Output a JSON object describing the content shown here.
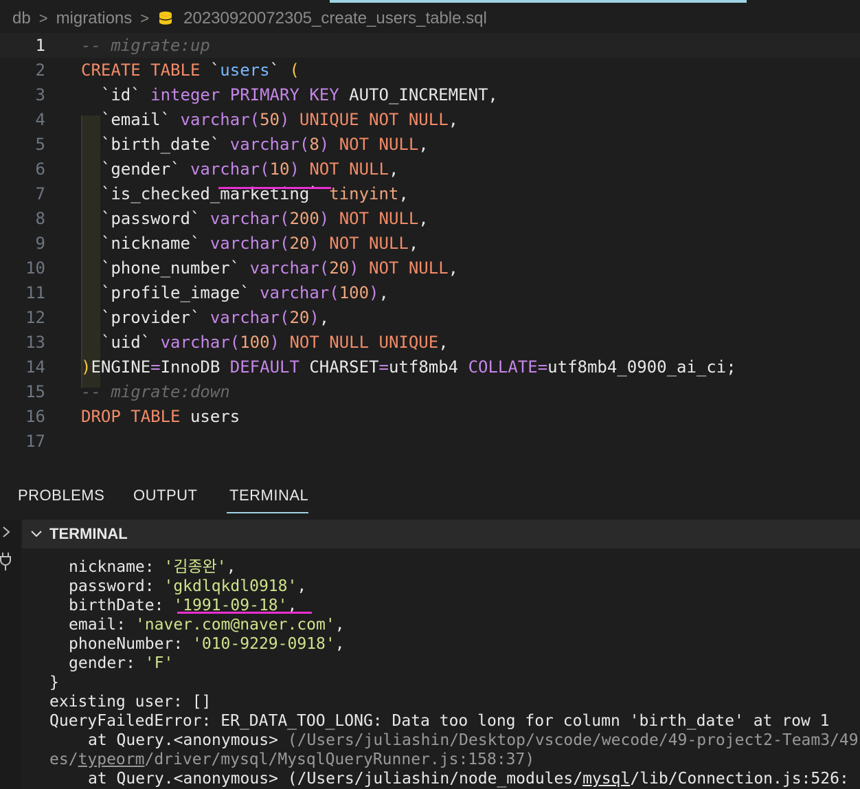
{
  "breadcrumb": {
    "items": [
      "db",
      "migrations",
      "20230920072305_create_users_table.sql"
    ],
    "separator": ">"
  },
  "editor": {
    "lines": [
      {
        "num": "1",
        "parts": [
          {
            "cls": "c",
            "text": "-- migrate:up"
          }
        ]
      },
      {
        "num": "2",
        "parts": [
          {
            "cls": "k",
            "text": "CREATE TABLE "
          },
          {
            "cls": "w",
            "text": "`"
          },
          {
            "cls": "b",
            "text": "users"
          },
          {
            "cls": "w",
            "text": "` "
          },
          {
            "cls": "p",
            "text": "("
          }
        ]
      },
      {
        "num": "3",
        "parts": [
          {
            "cls": "w",
            "text": "  `id` "
          },
          {
            "cls": "t",
            "text": "integer "
          },
          {
            "cls": "t",
            "text": "PRIMARY KEY "
          },
          {
            "cls": "w",
            "text": "AUTO_INCREMENT,"
          }
        ]
      },
      {
        "num": "4",
        "parts": [
          {
            "cls": "w",
            "text": "  `email` "
          },
          {
            "cls": "t",
            "text": "varchar("
          },
          {
            "cls": "n",
            "text": "50"
          },
          {
            "cls": "t",
            "text": ") "
          },
          {
            "cls": "k",
            "text": "UNIQUE NOT NULL"
          },
          {
            "cls": "w",
            "text": ","
          }
        ]
      },
      {
        "num": "5",
        "parts": [
          {
            "cls": "w",
            "text": "  `birth_date` "
          },
          {
            "cls": "t",
            "text": "varchar("
          },
          {
            "cls": "n",
            "text": "8"
          },
          {
            "cls": "t",
            "text": ") "
          },
          {
            "cls": "k",
            "text": "NOT NULL"
          },
          {
            "cls": "w",
            "text": ","
          }
        ]
      },
      {
        "num": "6",
        "parts": [
          {
            "cls": "w",
            "text": "  `gender` "
          },
          {
            "cls": "t",
            "text": "varchar("
          },
          {
            "cls": "n",
            "text": "10"
          },
          {
            "cls": "t",
            "text": ") "
          },
          {
            "cls": "k",
            "text": "NOT NULL"
          },
          {
            "cls": "w",
            "text": ","
          }
        ]
      },
      {
        "num": "7",
        "parts": [
          {
            "cls": "w",
            "text": "  `is_checked_marketing` "
          },
          {
            "cls": "n",
            "text": "tinyint"
          },
          {
            "cls": "w",
            "text": ","
          }
        ]
      },
      {
        "num": "8",
        "parts": [
          {
            "cls": "w",
            "text": "  `password` "
          },
          {
            "cls": "t",
            "text": "varchar("
          },
          {
            "cls": "n",
            "text": "200"
          },
          {
            "cls": "t",
            "text": ") "
          },
          {
            "cls": "k",
            "text": "NOT NULL"
          },
          {
            "cls": "w",
            "text": ","
          }
        ]
      },
      {
        "num": "9",
        "parts": [
          {
            "cls": "w",
            "text": "  `nickname` "
          },
          {
            "cls": "t",
            "text": "varchar("
          },
          {
            "cls": "n",
            "text": "20"
          },
          {
            "cls": "t",
            "text": ") "
          },
          {
            "cls": "k",
            "text": "NOT NULL"
          },
          {
            "cls": "w",
            "text": ","
          }
        ]
      },
      {
        "num": "10",
        "parts": [
          {
            "cls": "w",
            "text": "  `phone_number` "
          },
          {
            "cls": "t",
            "text": "varchar("
          },
          {
            "cls": "n",
            "text": "20"
          },
          {
            "cls": "t",
            "text": ") "
          },
          {
            "cls": "k",
            "text": "NOT NULL"
          },
          {
            "cls": "w",
            "text": ","
          }
        ]
      },
      {
        "num": "11",
        "parts": [
          {
            "cls": "w",
            "text": "  `profile_image` "
          },
          {
            "cls": "t",
            "text": "varchar("
          },
          {
            "cls": "n",
            "text": "100"
          },
          {
            "cls": "t",
            "text": ")"
          },
          {
            "cls": "w",
            "text": ","
          }
        ]
      },
      {
        "num": "12",
        "parts": [
          {
            "cls": "w",
            "text": "  `provider` "
          },
          {
            "cls": "t",
            "text": "varchar("
          },
          {
            "cls": "n",
            "text": "20"
          },
          {
            "cls": "t",
            "text": ")"
          },
          {
            "cls": "w",
            "text": ","
          }
        ]
      },
      {
        "num": "13",
        "parts": [
          {
            "cls": "w",
            "text": "  `uid` "
          },
          {
            "cls": "t",
            "text": "varchar("
          },
          {
            "cls": "n",
            "text": "100"
          },
          {
            "cls": "t",
            "text": ") "
          },
          {
            "cls": "k",
            "text": "NOT NULL UNIQUE"
          },
          {
            "cls": "w",
            "text": ","
          }
        ]
      },
      {
        "num": "14",
        "parts": [
          {
            "cls": "p",
            "text": ")"
          },
          {
            "cls": "w",
            "text": "ENGINE"
          },
          {
            "cls": "t",
            "text": "="
          },
          {
            "cls": "w",
            "text": "InnoDB "
          },
          {
            "cls": "t",
            "text": "DEFAULT "
          },
          {
            "cls": "w",
            "text": "CHARSET"
          },
          {
            "cls": "t",
            "text": "="
          },
          {
            "cls": "w",
            "text": "utf8mb4 "
          },
          {
            "cls": "t",
            "text": "COLLATE"
          },
          {
            "cls": "t",
            "text": "="
          },
          {
            "cls": "w",
            "text": "utf8mb4_0900_ai_ci;"
          }
        ]
      },
      {
        "num": "15",
        "parts": [
          {
            "cls": "c",
            "text": "-- migrate:down"
          }
        ]
      },
      {
        "num": "16",
        "parts": [
          {
            "cls": "k",
            "text": "DROP TABLE "
          },
          {
            "cls": "w",
            "text": "users"
          }
        ]
      },
      {
        "num": "17",
        "parts": []
      }
    ]
  },
  "panel": {
    "tabs": [
      "PROBLEMS",
      "OUTPUT",
      "TERMINAL"
    ],
    "active_tab": "TERMINAL",
    "section_title": "TERMINAL"
  },
  "terminal": {
    "lines": [
      {
        "indent": 68,
        "parts": [
          {
            "cls": "w",
            "text": "nickname: "
          },
          {
            "cls": "s",
            "text": "'김종완'"
          },
          {
            "cls": "w",
            "text": ","
          }
        ]
      },
      {
        "indent": 68,
        "parts": [
          {
            "cls": "w",
            "text": "password: "
          },
          {
            "cls": "s",
            "text": "'gkdlqkdl0918'"
          },
          {
            "cls": "w",
            "text": ","
          }
        ]
      },
      {
        "indent": 68,
        "parts": [
          {
            "cls": "w",
            "text": "birthDate: "
          },
          {
            "cls": "s",
            "text": "'1991-09-18'"
          },
          {
            "cls": "w",
            "text": ","
          }
        ]
      },
      {
        "indent": 68,
        "parts": [
          {
            "cls": "w",
            "text": "email: "
          },
          {
            "cls": "s",
            "text": "'naver.com@naver.com'"
          },
          {
            "cls": "w",
            "text": ","
          }
        ]
      },
      {
        "indent": 68,
        "parts": [
          {
            "cls": "w",
            "text": "phoneNumber: "
          },
          {
            "cls": "s",
            "text": "'010-9229-0918'"
          },
          {
            "cls": "w",
            "text": ","
          }
        ]
      },
      {
        "indent": 68,
        "parts": [
          {
            "cls": "w",
            "text": "gender: "
          },
          {
            "cls": "s",
            "text": "'F'"
          }
        ]
      },
      {
        "indent": 40,
        "parts": [
          {
            "cls": "w",
            "text": "}"
          }
        ]
      },
      {
        "indent": 40,
        "parts": [
          {
            "cls": "w",
            "text": "existing user: []"
          }
        ]
      },
      {
        "indent": 40,
        "parts": [
          {
            "cls": "w",
            "text": "QueryFailedError: ER_DATA_TOO_LONG: Data too long for column 'birth_date' at row 1"
          }
        ]
      },
      {
        "indent": 96,
        "parts": [
          {
            "cls": "w",
            "text": "at Query.<anonymous> "
          },
          {
            "cls": "gray",
            "text": "(/Users/juliashin/Desktop/vscode/wecode/49-project2-Team3/49"
          }
        ]
      },
      {
        "indent": 40,
        "parts": [
          {
            "cls": "gray",
            "text": "es/"
          },
          {
            "cls": "gray ul",
            "text": "typeorm"
          },
          {
            "cls": "gray",
            "text": "/driver/mysql/MysqlQueryRunner.js:158:37)"
          }
        ]
      },
      {
        "indent": 96,
        "parts": [
          {
            "cls": "w",
            "text": "at Query.<anonymous> "
          },
          {
            "cls": "w",
            "text": "(/Users/juliashin/node_modules/"
          },
          {
            "cls": "w ul",
            "text": "mysql"
          },
          {
            "cls": "w",
            "text": "/lib/Connection.js:526:"
          }
        ]
      }
    ]
  },
  "colors": {
    "background": "#1e1e1e",
    "accent": "#9fd2e4",
    "highlight_underline": "#e930d0"
  },
  "icons": [
    "database-icon",
    "chevron-right-icon",
    "chevron-down-icon",
    "plug-icon"
  ]
}
